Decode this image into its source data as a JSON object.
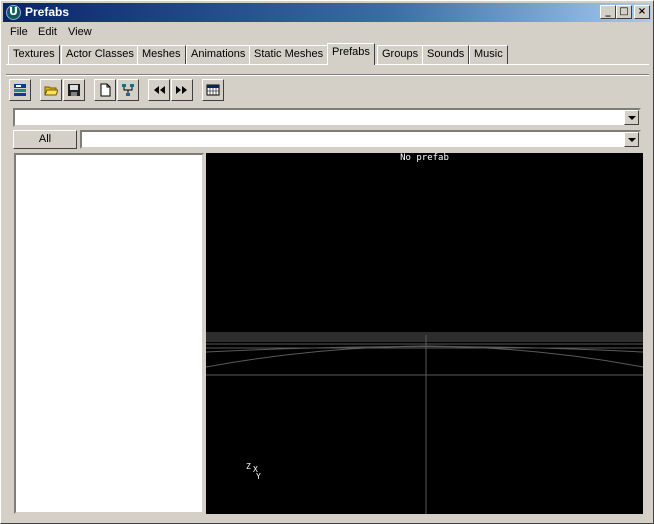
{
  "window": {
    "title": "Prefabs"
  },
  "titlebar": {
    "minimize": "_",
    "maximize": "□",
    "close": "×"
  },
  "menu": [
    "File",
    "Edit",
    "View"
  ],
  "tabs": [
    {
      "label": "Textures"
    },
    {
      "label": "Actor Classes"
    },
    {
      "label": "Meshes"
    },
    {
      "label": "Animations"
    },
    {
      "label": "Static Meshes"
    },
    {
      "label": "Prefabs",
      "active": true
    },
    {
      "label": "Groups"
    },
    {
      "label": "Sounds"
    },
    {
      "label": "Music"
    }
  ],
  "toolbar": {
    "buttons": [
      {
        "icon": "browser-layout-icon"
      },
      {
        "icon": "open-folder-icon"
      },
      {
        "icon": "save-disk-icon"
      },
      {
        "icon": "new-document-icon"
      },
      {
        "icon": "hierarchy-icon"
      },
      {
        "icon": "rewind-icon"
      },
      {
        "icon": "fast-forward-icon"
      },
      {
        "icon": "calendar-grid-icon"
      }
    ]
  },
  "package_combo": {
    "value": ""
  },
  "filter": {
    "all_label": "All",
    "group_value": ""
  },
  "viewport": {
    "status": "No prefab",
    "axis_labels": [
      "Z",
      "X",
      "Y"
    ]
  },
  "colors": {
    "titlebar_start": "#0a246a",
    "titlebar_end": "#a6caf0",
    "face": "#d4d0c8",
    "viewport_bg": "#000000",
    "grid": "#5a5a5a"
  }
}
